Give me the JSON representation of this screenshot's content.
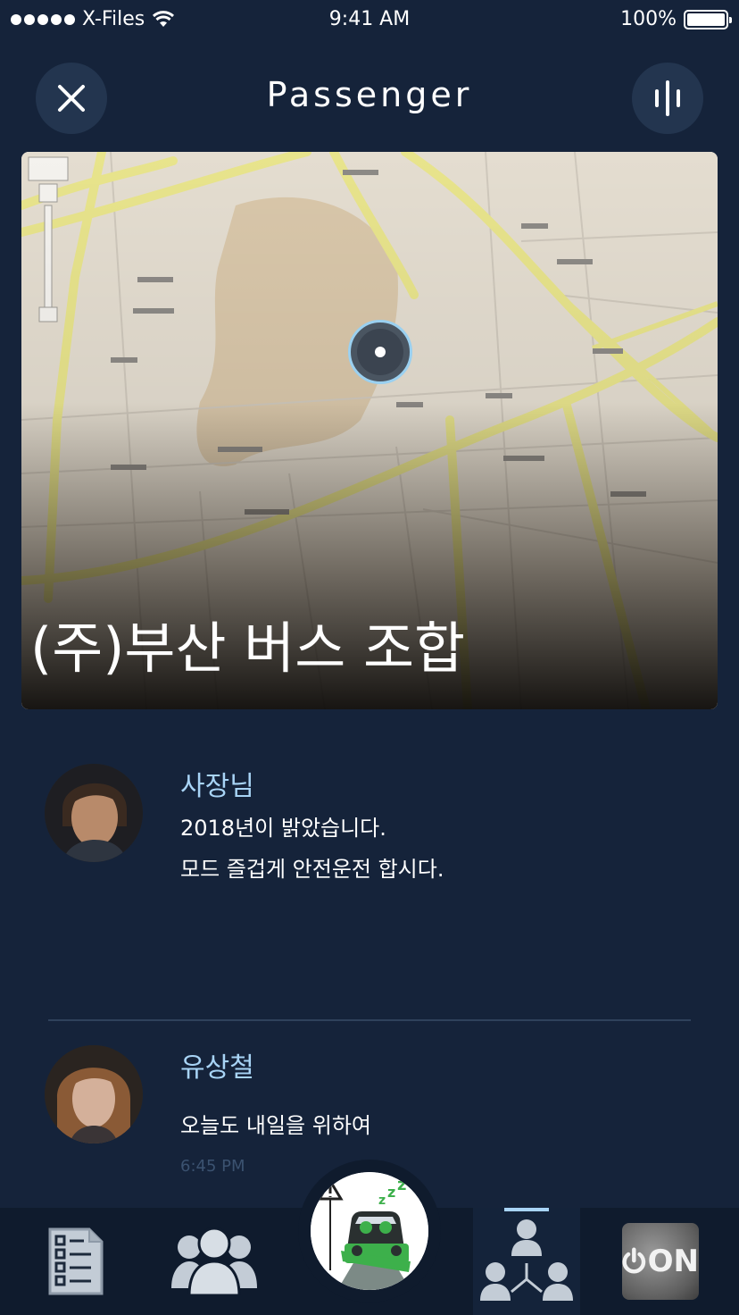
{
  "status_bar": {
    "carrier": "X-Files",
    "time": "9:41 AM",
    "battery": "100%"
  },
  "header": {
    "title": "Passenger",
    "close_icon": "close-icon",
    "menu_icon": "audio-bars-icon"
  },
  "map": {
    "title": "(주)부산 버스 조합",
    "pin_icon": "location-pin-icon"
  },
  "messages": [
    {
      "sender": "사장님",
      "lines": [
        "2018년이 밝았습니다.",
        "모드 즐겁게 안전운전 합시다."
      ]
    },
    {
      "sender": "유상철",
      "lines": [
        "오늘도 내일을 위하여"
      ],
      "time": "6:45 PM"
    }
  ],
  "tab_bar": {
    "tabs": [
      {
        "icon": "checklist-icon"
      },
      {
        "icon": "group-icon"
      },
      {
        "icon": "drowsy-driver-icon"
      },
      {
        "icon": "org-chart-icon",
        "selected": true
      },
      {
        "icon": "power-on-icon"
      }
    ],
    "power_label": "ON"
  },
  "colors": {
    "background": "#15233a",
    "accent": "#a8d4f6",
    "tab_bar": "#0f1b2d"
  }
}
